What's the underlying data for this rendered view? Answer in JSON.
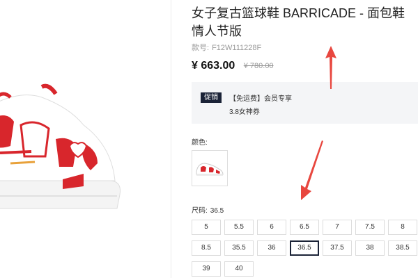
{
  "product": {
    "title": "女子复古篮球鞋 BARRICADE - 面包鞋情人节版",
    "sku_label": "款号:",
    "sku_value": "F12W111228F",
    "price": "¥ 663.00",
    "original_price": "¥ 780.00"
  },
  "promo": {
    "badge": "促销",
    "line1": "【免运费】会员专享",
    "line2": "3.8女神券"
  },
  "color": {
    "label": "颜色:"
  },
  "size": {
    "label": "尺码:",
    "selected_value": "36.5",
    "options": [
      "5",
      "5.5",
      "6",
      "6.5",
      "7",
      "7.5",
      "8",
      "8.5",
      "35.5",
      "36",
      "36.5",
      "37.5",
      "38",
      "38.5",
      "39",
      "40"
    ]
  },
  "colors": {
    "accent": "#1b2337",
    "arrow": "#e8473f",
    "shoe_red": "#d8262c"
  }
}
